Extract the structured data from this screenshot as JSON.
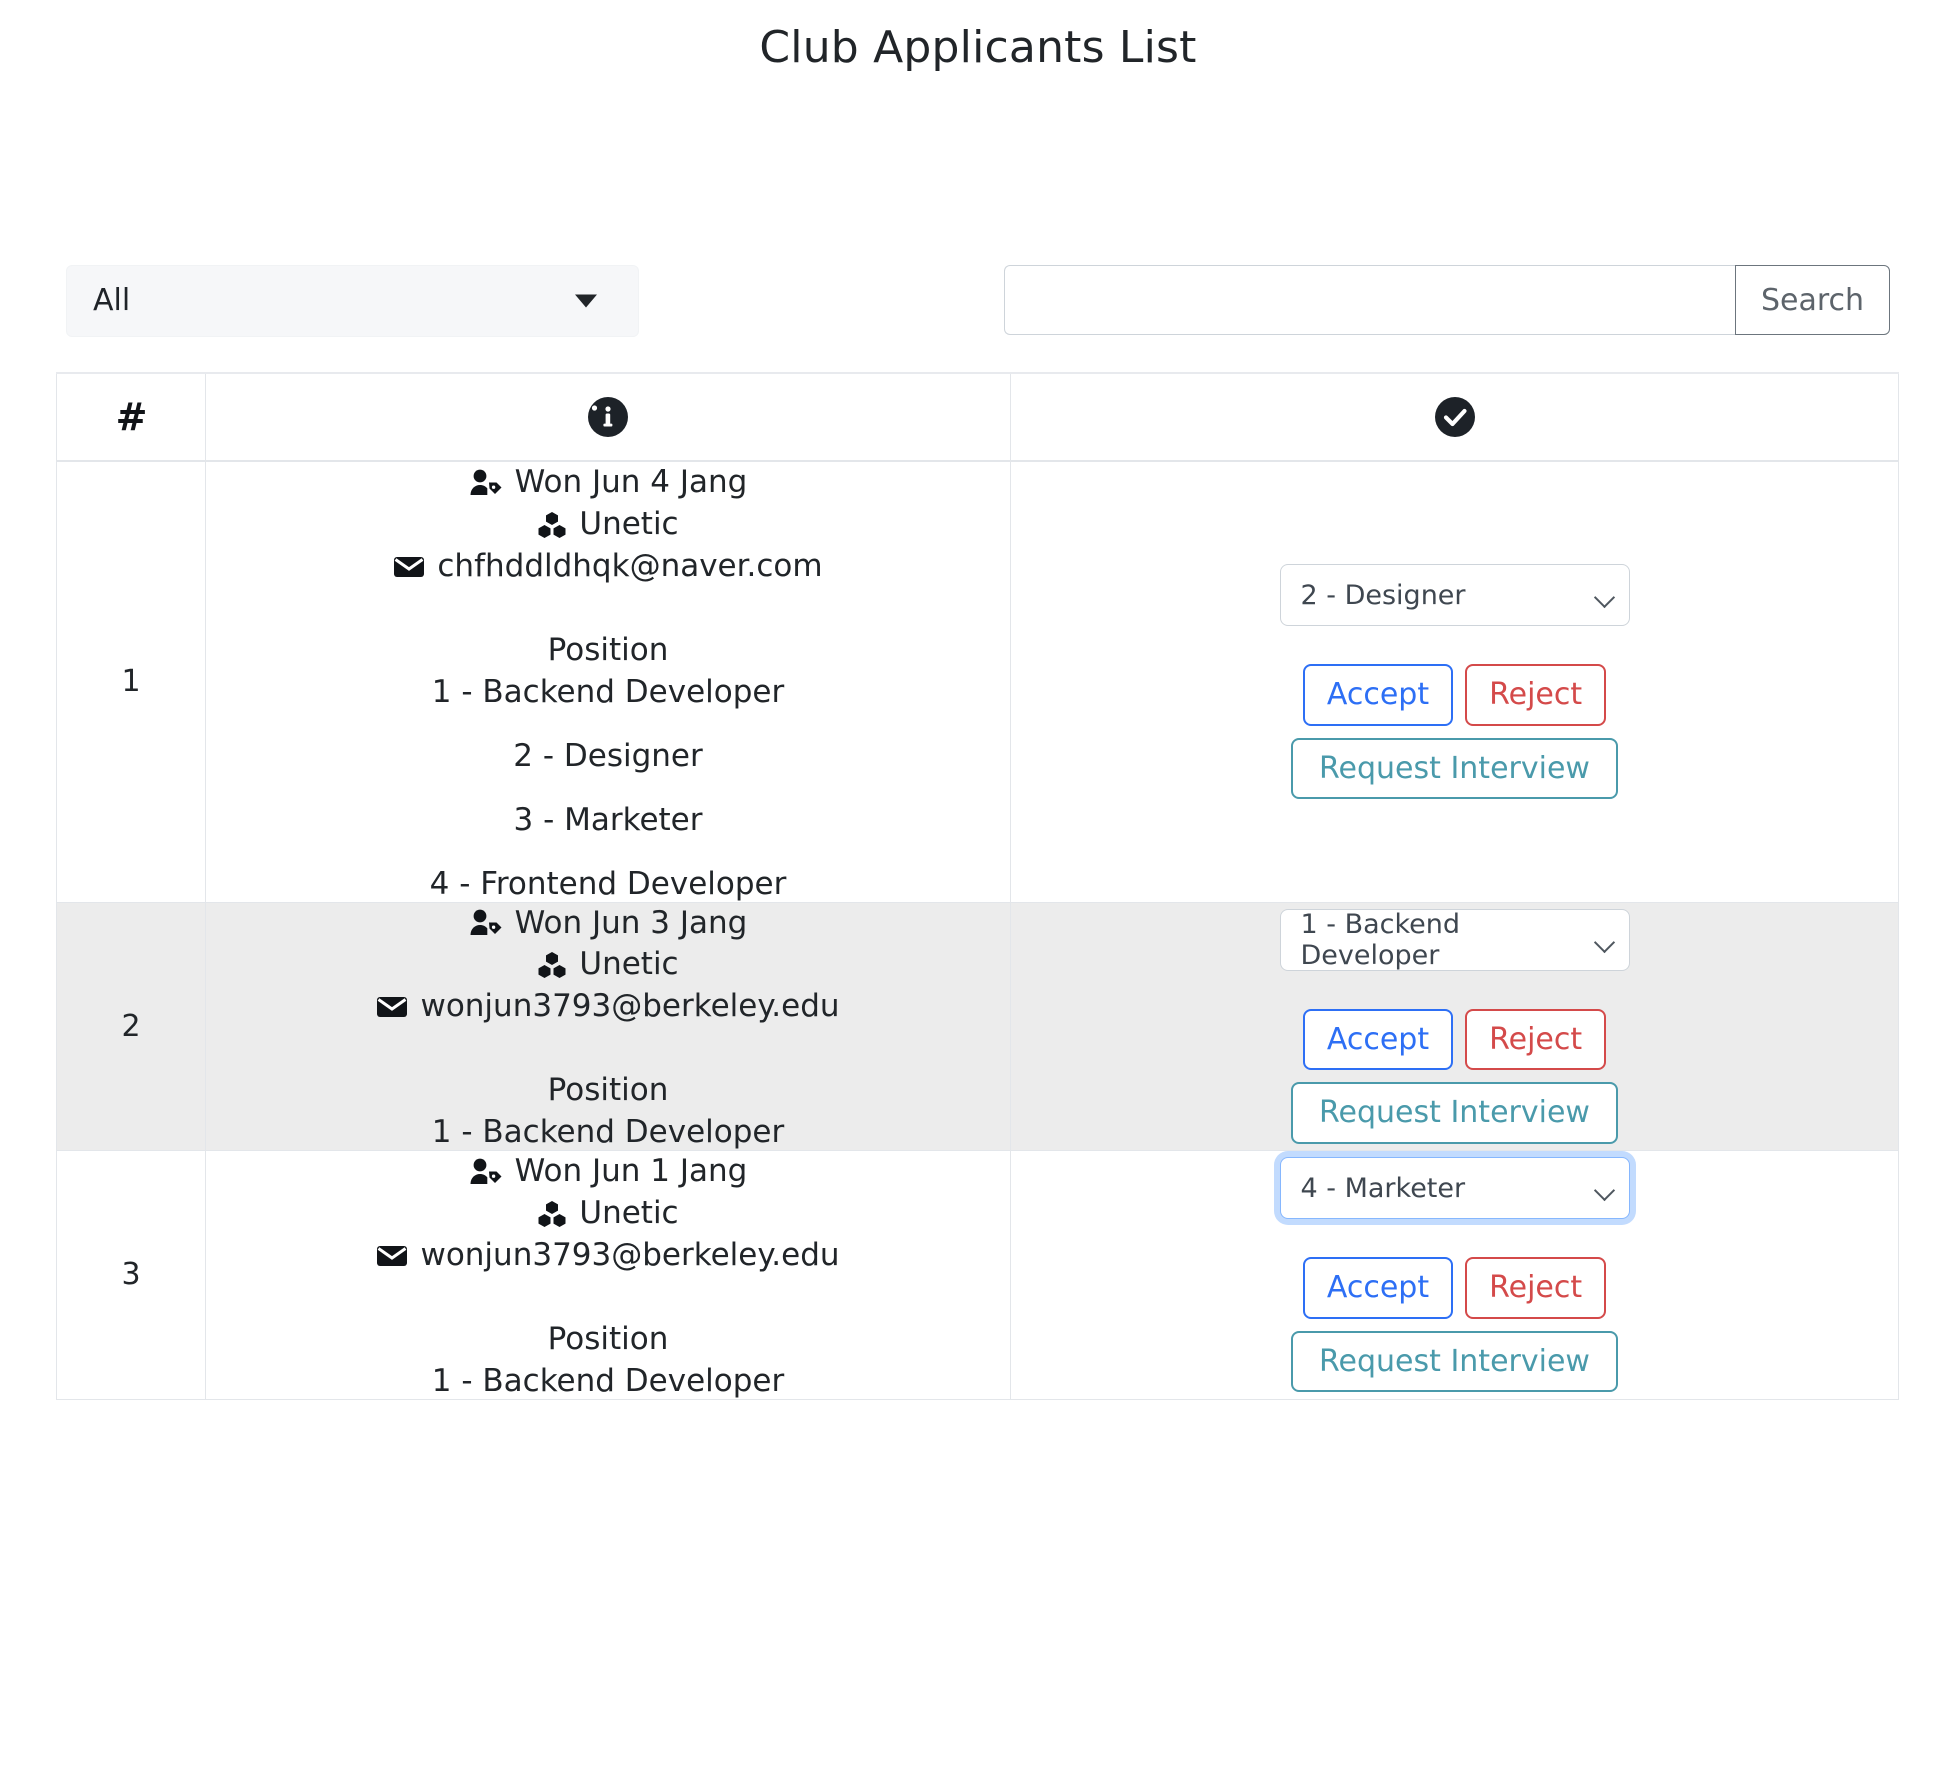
{
  "header": {
    "title": "Club Applicants List"
  },
  "filter": {
    "selected": "All",
    "icon": "caret-down-icon"
  },
  "search": {
    "value": "",
    "placeholder": "",
    "button_label": "Search"
  },
  "table": {
    "columns": [
      {
        "label": "#",
        "icon": "hash"
      },
      {
        "label": "",
        "icon": "info-circle-icon"
      },
      {
        "label": "",
        "icon": "check-circle-icon"
      }
    ],
    "rows": [
      {
        "num": "1",
        "name": "Won Jun 4 Jang",
        "org": "Unetic",
        "email": "chfhddldhqk@naver.com",
        "position_label": "Position",
        "positions": [
          "1 - Backend Developer",
          "2 - Designer",
          "3 - Marketer",
          "4 - Frontend Developer"
        ],
        "select_value": "2 - Designer",
        "select_focused": false,
        "striped": false,
        "accept_label": "Accept",
        "reject_label": "Reject",
        "interview_label": "Request Interview"
      },
      {
        "num": "2",
        "name": "Won Jun 3 Jang",
        "org": "Unetic",
        "email": "wonjun3793@berkeley.edu",
        "position_label": "Position",
        "positions": [
          "1 - Backend Developer"
        ],
        "select_value": "1 - Backend Developer",
        "select_focused": false,
        "striped": true,
        "accept_label": "Accept",
        "reject_label": "Reject",
        "interview_label": "Request Interview"
      },
      {
        "num": "3",
        "name": "Won Jun 1 Jang",
        "org": "Unetic",
        "email": "wonjun3793@berkeley.edu",
        "position_label": "Position",
        "positions": [
          "1 - Backend Developer"
        ],
        "select_value": "4 - Marketer",
        "select_focused": true,
        "striped": false,
        "accept_label": "Accept",
        "reject_label": "Reject",
        "interview_label": "Request Interview"
      }
    ]
  },
  "colors": {
    "accept": "#2d6ff5",
    "reject": "#d44a4a",
    "interview": "#4a9aab",
    "header_icon_bg": "#1d2228",
    "stripe": "#ececec",
    "focus_ring": "#86b7fe"
  }
}
